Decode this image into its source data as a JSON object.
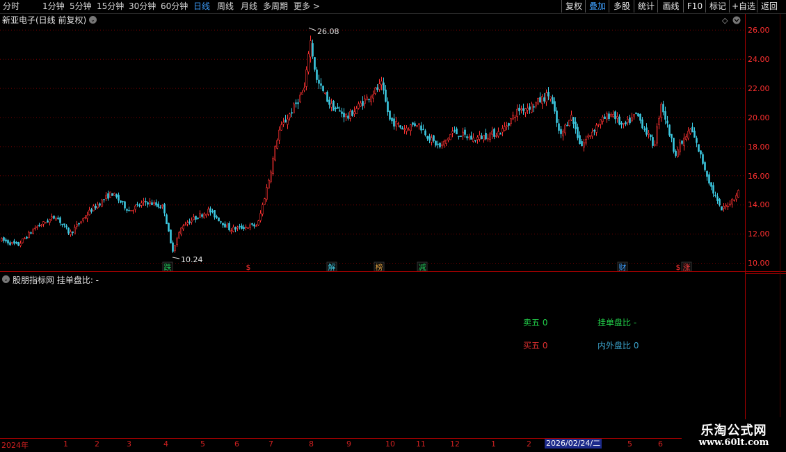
{
  "toolbar": {
    "periods": [
      "分时",
      "1分钟",
      "5分钟",
      "15分钟",
      "30分钟",
      "60分钟",
      "日线",
      "周线",
      "月线",
      "多周期",
      "更多 >"
    ],
    "active_period": "日线",
    "right_buttons": [
      "复权",
      "叠加",
      "多股",
      "统计",
      "画线",
      "F10",
      "标记",
      "+自选",
      "返回"
    ],
    "active_right": "叠加"
  },
  "main_chart": {
    "title": "新亚电子(日线 前复权)",
    "high_label": "26.08",
    "low_label": "10.24",
    "price_axis": [
      "26.00",
      "24.00",
      "22.00",
      "20.00",
      "18.00",
      "16.00",
      "14.00",
      "12.00",
      "10.00"
    ],
    "right_edge_glyph": "◇",
    "event_markers": [
      {
        "text": "跌",
        "color": "#22c45a",
        "boxed": true
      },
      {
        "text": "$",
        "color": "#ff3030",
        "boxed": false
      },
      {
        "text": "解",
        "color": "#40c8e0",
        "boxed": true
      },
      {
        "text": "榜",
        "color": "#d89a40",
        "boxed": true
      },
      {
        "text": "减",
        "color": "#22c45a",
        "boxed": true
      },
      {
        "text": "财",
        "color": "#40a0ff",
        "boxed": true
      },
      {
        "text": "$",
        "color": "#ff3030",
        "boxed": false
      },
      {
        "text": "涨",
        "color": "#ff4040",
        "boxed": true
      }
    ]
  },
  "indicator": {
    "title": "股朋指标网  挂单盘比: -",
    "sell5": "卖五 0",
    "ratio": "挂单盘比 -",
    "buy5": "买五 0",
    "inout": "内外盘比 0",
    "colors": {
      "sell5": "#22d04a",
      "ratio": "#22d04a",
      "buy5": "#e03030",
      "inout": "#3aa0c8"
    }
  },
  "date_axis": {
    "labels": [
      "2024年",
      "1",
      "2",
      "3",
      "4",
      "5",
      "6",
      "7",
      "8",
      "9",
      "10",
      "11",
      "12",
      "1",
      "2",
      "3",
      "4",
      "5",
      "6"
    ],
    "current_date": "2026/02/24/二"
  },
  "watermark": {
    "title": "乐淘公式网",
    "url": "www.60lt.com"
  },
  "colors": {
    "up": "#ff3232",
    "down": "#3cc8e0",
    "grid": "#7a0000",
    "axis_text": "#ff3030",
    "border": "#a00000"
  }
}
